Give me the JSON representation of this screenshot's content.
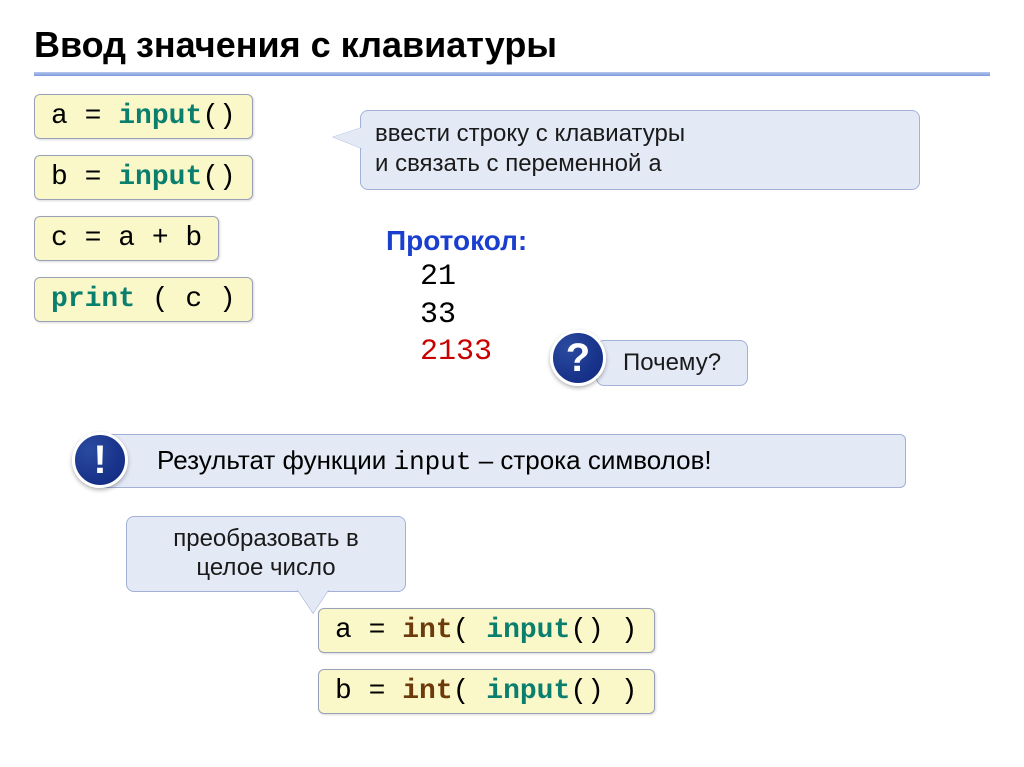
{
  "title": "Ввод значения с клавиатуры",
  "code": {
    "line1_a": "a",
    "line1_eq": " = ",
    "line1_fn": "input",
    "line1_paren": "()",
    "line2_a": "b",
    "line2_eq": " = ",
    "line2_fn": "input",
    "line2_paren": "()",
    "line3": "c = a + b",
    "line4_fn": "print",
    "line4_arg": " ( c )",
    "line5_a": "a",
    "line5_eq": " = ",
    "line5_int": "int",
    "line5_open": "( ",
    "line5_fn": "input",
    "line5_paren": "()",
    "line5_close": " )",
    "line6_a": "b",
    "line6_eq": " = ",
    "line6_int": "int",
    "line6_open": "( ",
    "line6_fn": "input",
    "line6_paren": "()",
    "line6_close": " )"
  },
  "callouts": {
    "top_line1": "ввести строку с клавиатуры",
    "top_line2_a": "и связать с переменной ",
    "top_line2_b": "a",
    "why": "Почему?",
    "convert_line1": "преобразовать в",
    "convert_line2": "целое число"
  },
  "protocol": {
    "label": "Протокол:",
    "v1": "21",
    "v2": "33",
    "v3": "2133"
  },
  "infobar": {
    "pre": "Результат функции ",
    "fn": "input",
    "post": " – строка символов!"
  },
  "badges": {
    "question": "?",
    "exclaim": "!"
  }
}
